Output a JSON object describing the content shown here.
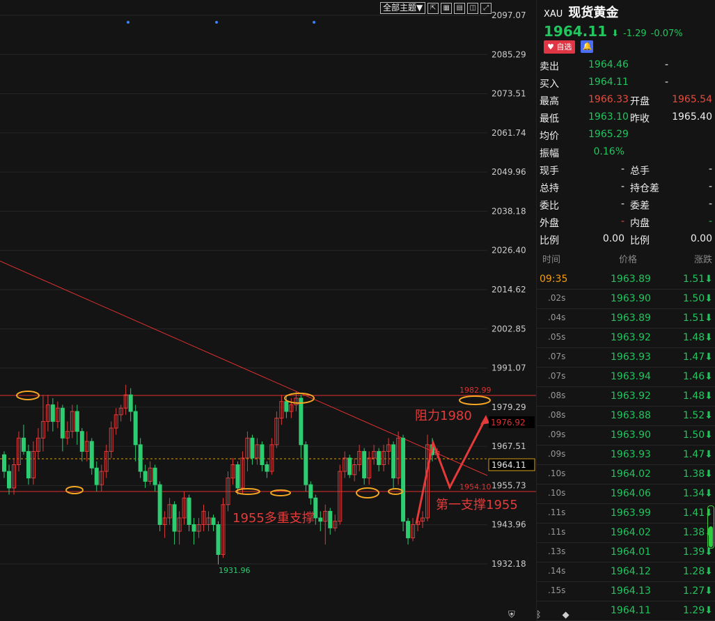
{
  "toolbar": {
    "theme_label": "全部主题▼",
    "icons": [
      "expand-icon",
      "grid-icon",
      "chart-icon",
      "layout-icon",
      "fullscreen-icon"
    ]
  },
  "quote": {
    "symbol": "XAU",
    "name": "现货黄金",
    "price": "1964.11",
    "arrow": "⬇",
    "change": "-1.29",
    "change_pct": "-0.07%",
    "fav_label": "♥ 自选",
    "fields": [
      {
        "l": "卖出",
        "v": "1964.46",
        "vc": "g",
        "l2": "-",
        "v2": "",
        "v2c": "w"
      },
      {
        "l": "买入",
        "v": "1964.11",
        "vc": "g",
        "l2": "-",
        "v2": "",
        "v2c": "w"
      },
      {
        "l": "最高",
        "v": "1966.33",
        "vc": "r",
        "l2": "开盘",
        "v2": "1965.54",
        "v2c": "r"
      },
      {
        "l": "最低",
        "v": "1963.10",
        "vc": "g",
        "l2": "昨收",
        "v2": "1965.40",
        "v2c": "w"
      },
      {
        "l": "均价",
        "v": "1965.29",
        "vc": "g",
        "l2": "",
        "v2": "",
        "v2c": "w"
      },
      {
        "l": "振幅",
        "v": "0.16%",
        "vc": "g",
        "l2": "",
        "v2": "",
        "v2c": "w"
      },
      {
        "l": "现手",
        "v": "-",
        "vc": "w",
        "l2": "总手",
        "v2": "-",
        "v2c": "w"
      },
      {
        "l": "总持",
        "v": "-",
        "vc": "w",
        "l2": "持仓差",
        "v2": "-",
        "v2c": "w"
      },
      {
        "l": "委比",
        "v": "-",
        "vc": "w",
        "l2": "委差",
        "v2": "-",
        "v2c": "w"
      },
      {
        "l": "外盘",
        "v": "-",
        "vc": "r",
        "l2": "内盘",
        "v2": "-",
        "v2c": "g"
      },
      {
        "l": "比例",
        "v": "0.00",
        "vc": "w",
        "l2": "比例",
        "v2": "0.00",
        "v2c": "w"
      }
    ],
    "ticks_header": [
      "时间",
      "价格",
      "涨跌"
    ],
    "ticks": [
      {
        "t": "09:35",
        "p": "1963.89",
        "c": "1.51⬇"
      },
      {
        "t": ".02s",
        "p": "1963.90",
        "c": "1.50⬇"
      },
      {
        "t": ".04s",
        "p": "1963.89",
        "c": "1.51⬇"
      },
      {
        "t": ".05s",
        "p": "1963.92",
        "c": "1.48⬇"
      },
      {
        "t": ".07s",
        "p": "1963.93",
        "c": "1.47⬇"
      },
      {
        "t": ".07s",
        "p": "1963.94",
        "c": "1.46⬇"
      },
      {
        "t": ".08s",
        "p": "1963.92",
        "c": "1.48⬇"
      },
      {
        "t": ".08s",
        "p": "1963.88",
        "c": "1.52⬇"
      },
      {
        "t": ".09s",
        "p": "1963.90",
        "c": "1.50⬇"
      },
      {
        "t": ".09s",
        "p": "1963.93",
        "c": "1.47⬇"
      },
      {
        "t": ".10s",
        "p": "1964.02",
        "c": "1.38⬇"
      },
      {
        "t": ".10s",
        "p": "1964.06",
        "c": "1.34⬇"
      },
      {
        "t": ".11s",
        "p": "1963.99",
        "c": "1.41⬇"
      },
      {
        "t": ".11s",
        "p": "1964.02",
        "c": "1.38⬇"
      },
      {
        "t": ".13s",
        "p": "1964.01",
        "c": "1.39⬇"
      },
      {
        "t": ".14s",
        "p": "1964.12",
        "c": "1.28⬇"
      },
      {
        "t": ".15s",
        "p": "1964.13",
        "c": "1.27⬇"
      },
      {
        "t": "",
        "p": "1964.11",
        "c": "1.29⬇"
      }
    ]
  },
  "chart_data": {
    "type": "candlestick",
    "y_ticks": [
      "2097.07",
      "2085.29",
      "2073.51",
      "2061.74",
      "2049.96",
      "2038.18",
      "2026.40",
      "2014.62",
      "2002.85",
      "1991.07",
      "1979.29",
      "1967.51",
      "1955.73",
      "1943.96",
      "1932.18"
    ],
    "ylim": [
      1926.3,
      2102.95
    ],
    "current_price_label": "1964.11",
    "resistance_label": "1982.99",
    "support_label": "1954.10",
    "target_label": "1976.92",
    "low_label": "1931.96",
    "annotations": [
      "阻力1980",
      "第一支撑1955",
      "1955多重支撑"
    ],
    "colors": {
      "up": "#e23b3b",
      "down": "#2ecc71",
      "resistance_line": "#e03030",
      "ellipse": "#f5a623",
      "annotation": "#e53a3a"
    },
    "candles": [
      [
        1965,
        1960,
        1966,
        1958
      ],
      [
        1960,
        1955,
        1962,
        1953
      ],
      [
        1955,
        1962,
        1964,
        1953
      ],
      [
        1962,
        1970,
        1972,
        1960
      ],
      [
        1970,
        1966,
        1974,
        1965
      ],
      [
        1966,
        1958,
        1968,
        1956
      ],
      [
        1958,
        1966,
        1969,
        1956
      ],
      [
        1966,
        1970,
        1973,
        1964
      ],
      [
        1970,
        1975,
        1983,
        1966
      ],
      [
        1975,
        1980,
        1983,
        1972
      ],
      [
        1980,
        1975,
        1982,
        1972
      ],
      [
        1975,
        1979,
        1981,
        1973
      ],
      [
        1979,
        1970,
        1980,
        1966
      ],
      [
        1970,
        1972,
        1975,
        1968
      ],
      [
        1972,
        1978,
        1980,
        1970
      ],
      [
        1978,
        1972,
        1980,
        1968
      ],
      [
        1972,
        1966,
        1973,
        1963
      ],
      [
        1966,
        1969,
        1972,
        1963
      ],
      [
        1969,
        1961,
        1970,
        1959
      ],
      [
        1961,
        1956,
        1963,
        1954
      ],
      [
        1956,
        1960,
        1962,
        1954
      ],
      [
        1960,
        1966,
        1968,
        1958
      ],
      [
        1966,
        1973,
        1975,
        1964
      ],
      [
        1973,
        1977,
        1979,
        1971
      ],
      [
        1977,
        1979,
        1980,
        1975
      ],
      [
        1979,
        1983,
        1986,
        1977
      ],
      [
        1983,
        1978,
        1985,
        1975
      ],
      [
        1978,
        1968,
        1980,
        1963
      ],
      [
        1968,
        1960,
        1970,
        1958
      ],
      [
        1960,
        1957,
        1962,
        1955
      ],
      [
        1957,
        1961,
        1963,
        1956
      ],
      [
        1961,
        1956,
        1962,
        1954
      ],
      [
        1956,
        1944,
        1957,
        1942
      ],
      [
        1944,
        1946,
        1948,
        1940
      ],
      [
        1946,
        1950,
        1952,
        1944
      ],
      [
        1950,
        1942,
        1951,
        1938
      ],
      [
        1942,
        1946,
        1948,
        1938
      ],
      [
        1946,
        1952,
        1954,
        1944
      ],
      [
        1952,
        1944,
        1953,
        1942
      ],
      [
        1944,
        1942,
        1946,
        1938
      ],
      [
        1942,
        1944,
        1946,
        1940
      ],
      [
        1944,
        1948,
        1950,
        1942
      ],
      [
        1944,
        1946,
        1948,
        1942
      ],
      [
        1946,
        1944,
        1947,
        1942
      ],
      [
        1944,
        1935,
        1945,
        1932
      ],
      [
        1935,
        1950,
        1952,
        1934
      ],
      [
        1950,
        1958,
        1960,
        1948
      ],
      [
        1958,
        1962,
        1964,
        1956
      ],
      [
        1962,
        1955,
        1963,
        1953
      ],
      [
        1955,
        1964,
        1966,
        1953
      ],
      [
        1964,
        1970,
        1972,
        1960
      ],
      [
        1970,
        1964,
        1971,
        1962
      ],
      [
        1964,
        1968,
        1970,
        1962
      ],
      [
        1968,
        1962,
        1969,
        1960
      ],
      [
        1962,
        1960,
        1963,
        1958
      ],
      [
        1960,
        1968,
        1970,
        1959
      ],
      [
        1968,
        1976,
        1978,
        1967
      ],
      [
        1976,
        1981,
        1983,
        1974
      ],
      [
        1981,
        1978,
        1983,
        1976
      ],
      [
        1978,
        1980,
        1982,
        1976
      ],
      [
        1980,
        1982,
        1984,
        1978
      ],
      [
        1982,
        1968,
        1983,
        1964
      ],
      [
        1968,
        1956,
        1969,
        1954
      ],
      [
        1956,
        1952,
        1957,
        1950
      ],
      [
        1952,
        1946,
        1953,
        1944
      ],
      [
        1946,
        1945,
        1948,
        1942
      ],
      [
        1945,
        1948,
        1950,
        1938
      ],
      [
        1948,
        1943,
        1949,
        1941
      ],
      [
        1943,
        1945,
        1947,
        1942
      ],
      [
        1945,
        1960,
        1962,
        1944
      ],
      [
        1960,
        1964,
        1966,
        1958
      ],
      [
        1964,
        1959,
        1965,
        1958
      ],
      [
        1959,
        1962,
        1964,
        1957
      ],
      [
        1962,
        1966,
        1968,
        1960
      ],
      [
        1966,
        1958,
        1967,
        1956
      ],
      [
        1958,
        1964,
        1966,
        1956
      ],
      [
        1964,
        1966,
        1968,
        1962
      ],
      [
        1966,
        1962,
        1967,
        1960
      ],
      [
        1962,
        1966,
        1968,
        1960
      ],
      [
        1966,
        1968,
        1970,
        1962
      ],
      [
        1968,
        1958,
        1969,
        1955
      ],
      [
        1958,
        1970,
        1972,
        1956
      ],
      [
        1970,
        1945,
        1971,
        1942
      ],
      [
        1945,
        1940,
        1946,
        1938
      ],
      [
        1940,
        1944,
        1946,
        1939
      ],
      [
        1944,
        1945,
        1947,
        1942
      ],
      [
        1945,
        1946,
        1948,
        1943
      ],
      [
        1946,
        1968,
        1971,
        1945
      ],
      [
        1968,
        1965,
        1970,
        1963
      ],
      [
        1965,
        1966,
        1967,
        1964
      ]
    ]
  }
}
